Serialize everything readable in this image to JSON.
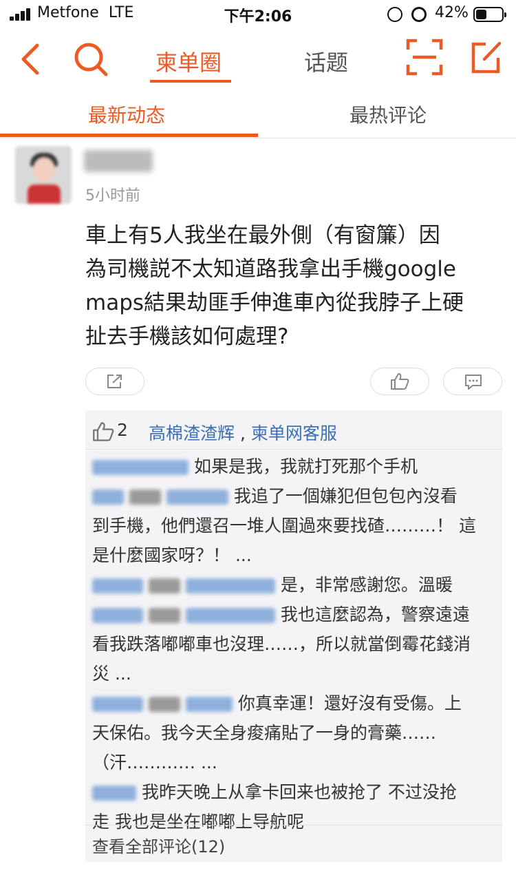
{
  "status_bar": {
    "carrier": "Metfone",
    "network": "LTE",
    "time": "下午2:06",
    "battery_percent": "42%",
    "battery_level": 0.42
  },
  "nav": {
    "back_icon": "chevron-left-icon",
    "search_icon": "search-icon",
    "tabs": [
      {
        "label": "柬单圈",
        "active": true
      },
      {
        "label": "话题",
        "active": false
      }
    ],
    "scan_icon": "scan-icon",
    "compose_icon": "compose-icon",
    "accent_color": "#ee5a24"
  },
  "subtabs": [
    {
      "label": "最新动态",
      "active": true
    },
    {
      "label": "最热评论",
      "active": false
    }
  ],
  "post": {
    "time": "5小时前",
    "lines": [
      "車上有5人我坐在最外側（有窗簾）因",
      "為司機説不太知道路我拿出手機google",
      "maps結果劫匪手伸進車內從我脖子上硬",
      "扯去手機該如何處理?"
    ],
    "actions": {
      "share_icon": "share-icon",
      "like_icon": "thumbs-up-icon",
      "comment_icon": "comment-icon"
    }
  },
  "comments_box": {
    "like_count": "2",
    "likers": [
      "高棉渣渣辉",
      "柬单网客服"
    ],
    "liker_separator": " , ",
    "comments": [
      {
        "lines": [
          "如果是我，我就打死那个手机"
        ]
      },
      {
        "lines": [
          "我追了一個嫌犯但包包內沒看",
          "到手機，他們還召一堆人圍過來要找碴………！ 這",
          "是什麼國家呀？！ ..."
        ]
      },
      {
        "lines": [
          "是，非常感謝您。溫暖"
        ]
      },
      {
        "lines": [
          "我也這麼認為，警察遠遠",
          "看我跌落嘟嘟車也沒理……，所以就當倒霉花錢消",
          "災 ..."
        ]
      },
      {
        "lines": [
          "你真幸運！還好沒有受傷。上",
          "天保佑。我今天全身痠痛貼了一身的膏藥……",
          "（汗………… ..."
        ]
      },
      {
        "lines": [
          "我昨天晚上从拿卡回来也被抢了 不过没抢",
          "走 我也是坐在嘟嘟上导航呢"
        ]
      }
    ],
    "view_all": "查看全部评论(12)"
  }
}
